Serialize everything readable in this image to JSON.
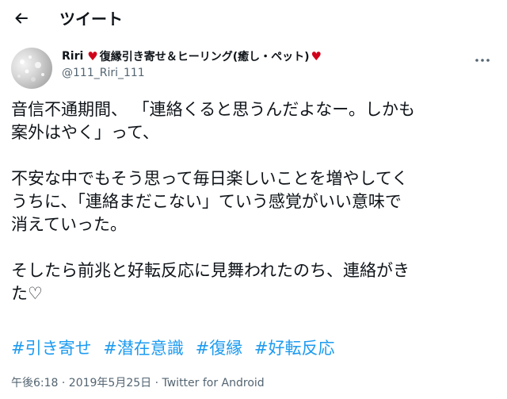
{
  "header": {
    "title": "ツイート",
    "back_icon": "arrow-left-icon"
  },
  "user": {
    "name_prefix": "Riri",
    "heart": "♥",
    "name_middle": "復縁引き寄せ＆ヒーリング(癒し・ペット)",
    "heart_end": "♥",
    "handle": "@111_Riri_111",
    "heart_color": "#d0021b"
  },
  "tweet": {
    "lines": [
      "音信不通期間、 「連絡くると思うんだよなー。しかも",
      "案外はやく」って、",
      "",
      "不安な中でもそう思って毎日楽しいことを増やしてく",
      "うちに、「連絡まだこない」ていう感覚がいい意味で",
      "消えていった。",
      "",
      "そしたら前兆と好転反応に見舞われたのち、連絡がき",
      "た♡"
    ],
    "hashtags": [
      "#引き寄せ",
      "#潜在意識",
      "#復縁",
      "#好転反応"
    ],
    "meta": "午後6:18 · 2019年5月25日 · Twitter for Android"
  },
  "colors": {
    "link": "#1d9bf0",
    "secondary": "#536471"
  }
}
